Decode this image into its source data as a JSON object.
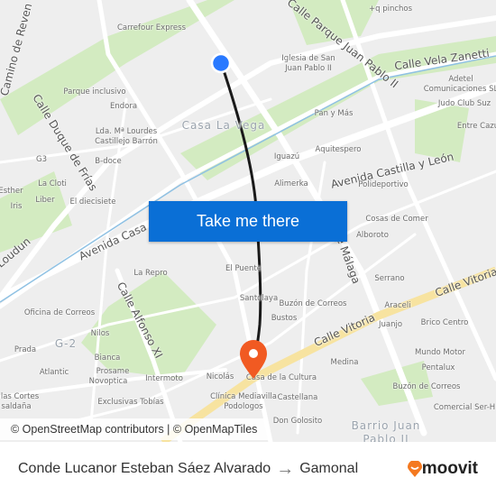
{
  "map": {
    "labels": [
      {
        "text": "Carrefour Express",
        "kind": "poi"
      },
      {
        "text": "+q pinchos",
        "kind": "poi"
      },
      {
        "text": "Iglesia de San",
        "kind": "poi"
      },
      {
        "text": "Juan Pablo II",
        "kind": "poi"
      },
      {
        "text": "Calle Vela Zanetti",
        "kind": "street"
      },
      {
        "text": "Adetel",
        "kind": "poi"
      },
      {
        "text": "Comunicaciones SL",
        "kind": "poi"
      },
      {
        "text": "Judo Club Suz",
        "kind": "poi"
      },
      {
        "text": "Parque inclusivo",
        "kind": "poi"
      },
      {
        "text": "Endora",
        "kind": "poi"
      },
      {
        "text": "Casa La Vega",
        "kind": "area"
      },
      {
        "text": "Pan y Más",
        "kind": "poi"
      },
      {
        "text": "Entre Cazu",
        "kind": "poi"
      },
      {
        "text": "Lda. Mª Lourdes",
        "kind": "poi"
      },
      {
        "text": "Castillejo Barrón",
        "kind": "poi"
      },
      {
        "text": "Aquitespero",
        "kind": "poi"
      },
      {
        "text": "Iguazú",
        "kind": "poi"
      },
      {
        "text": "G3",
        "kind": "poi"
      },
      {
        "text": "B-doce",
        "kind": "poi"
      },
      {
        "text": "Avenida Castilla y León",
        "kind": "street"
      },
      {
        "text": "Alimerka",
        "kind": "poi"
      },
      {
        "text": "Polideportivo",
        "kind": "poi"
      },
      {
        "text": "La Cloti",
        "kind": "poi"
      },
      {
        "text": "Esther",
        "kind": "poi"
      },
      {
        "text": "Liber",
        "kind": "poi"
      },
      {
        "text": "El diecisiete",
        "kind": "poi"
      },
      {
        "text": "Iris",
        "kind": "poi"
      },
      {
        "text": "Cosas de Comer",
        "kind": "poi"
      },
      {
        "text": "Alboroto",
        "kind": "poi"
      },
      {
        "text": "La Repro",
        "kind": "poi"
      },
      {
        "text": "El Puente",
        "kind": "poi"
      },
      {
        "text": "Serrano",
        "kind": "poi"
      },
      {
        "text": "Santolaya",
        "kind": "poi"
      },
      {
        "text": "Buzón de Correos",
        "kind": "poi"
      },
      {
        "text": "Araceli",
        "kind": "poi"
      },
      {
        "text": "Oficina de Correos",
        "kind": "poi"
      },
      {
        "text": "Juanjo",
        "kind": "poi"
      },
      {
        "text": "Brico Centro",
        "kind": "poi"
      },
      {
        "text": "Bustos",
        "kind": "poi"
      },
      {
        "text": "Nilos",
        "kind": "poi"
      },
      {
        "text": "G-2",
        "kind": "area"
      },
      {
        "text": "Prada",
        "kind": "poi"
      },
      {
        "text": "Mundo Motor",
        "kind": "poi"
      },
      {
        "text": "Bianca",
        "kind": "poi"
      },
      {
        "text": "Medina",
        "kind": "poi"
      },
      {
        "text": "Pentalux",
        "kind": "poi"
      },
      {
        "text": "Atlantic",
        "kind": "poi"
      },
      {
        "text": "Prosame",
        "kind": "poi"
      },
      {
        "text": "Novoptica",
        "kind": "poi"
      },
      {
        "text": "Intermoto",
        "kind": "poi"
      },
      {
        "text": "Nicolás",
        "kind": "poi"
      },
      {
        "text": "Casa de la Cultura",
        "kind": "poi"
      },
      {
        "text": "Buzón de Correos",
        "kind": "poi"
      },
      {
        "text": "las Cortes",
        "kind": "poi"
      },
      {
        "text": "Clínica Mediavilla",
        "kind": "poi"
      },
      {
        "text": "Castellana",
        "kind": "poi"
      },
      {
        "text": "saldaña",
        "kind": "poi"
      },
      {
        "text": "Exclusivas Tobías",
        "kind": "poi"
      },
      {
        "text": "Podologos",
        "kind": "poi"
      },
      {
        "text": "Comercial Ser-H",
        "kind": "poi"
      },
      {
        "text": "Don Golosito",
        "kind": "poi"
      },
      {
        "text": "Barrio Juan",
        "kind": "area"
      },
      {
        "text": "Pablo II",
        "kind": "area"
      },
      {
        "text": "Calle Duque de Frías",
        "kind": "street"
      },
      {
        "text": "Camino de Reven",
        "kind": "street"
      },
      {
        "text": "Calle Parque Juan Pablo II",
        "kind": "street"
      },
      {
        "text": "Loudun",
        "kind": "street"
      },
      {
        "text": "Avenida Casa",
        "kind": "street"
      },
      {
        "text": "Calle Alfonso XI",
        "kind": "street"
      },
      {
        "text": "Calle Vitoria",
        "kind": "street"
      },
      {
        "text": "Calle Vitoria",
        "kind": "street"
      },
      {
        "text": "de Málaga",
        "kind": "street"
      }
    ],
    "colors": {
      "origin": "#2979ff",
      "destination": "#f15a22",
      "route": "#1a1a1a",
      "highlight_road": "#f7e3a0",
      "park": "#c8e6b0",
      "water": "#8fc1e3"
    }
  },
  "cta": {
    "label": "Take me there"
  },
  "attribution": "© OpenStreetMap contributors | © OpenMapTiles",
  "footer": {
    "origin": "Conde Lucanor Esteban Sáez Alvarado",
    "arrow": "→",
    "destination": "Gamonal",
    "brand": "moovit"
  }
}
